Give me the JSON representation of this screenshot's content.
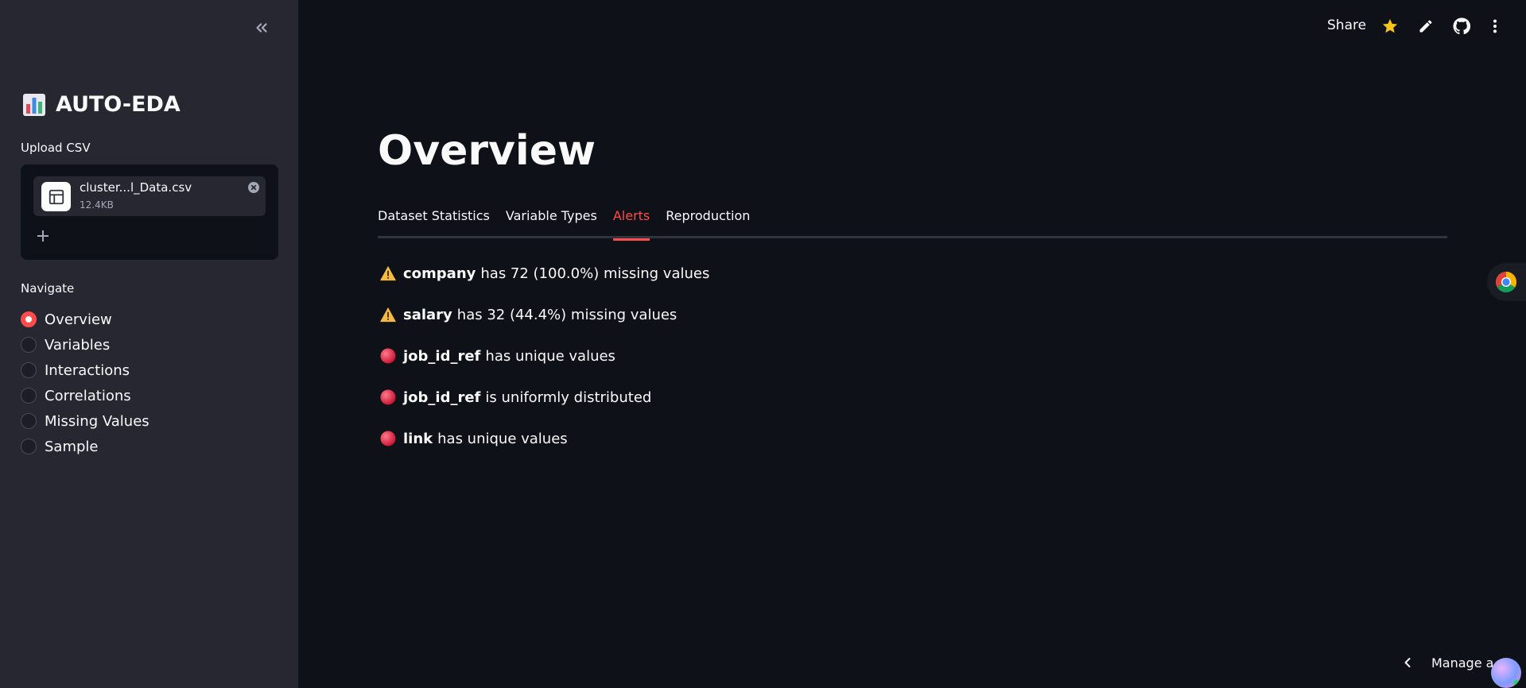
{
  "sidebar": {
    "title": "AUTO-EDA",
    "upload_label": "Upload CSV",
    "file": {
      "name": "cluster...l_Data.csv",
      "size": "12.4KB"
    },
    "nav_label": "Navigate",
    "nav_items": [
      {
        "label": "Overview",
        "selected": true
      },
      {
        "label": "Variables",
        "selected": false
      },
      {
        "label": "Interactions",
        "selected": false
      },
      {
        "label": "Correlations",
        "selected": false
      },
      {
        "label": "Missing Values",
        "selected": false
      },
      {
        "label": "Sample",
        "selected": false
      }
    ]
  },
  "header": {
    "share_label": "Share",
    "icons": [
      "star-icon",
      "pencil-icon",
      "github-icon",
      "more-vertical-icon"
    ]
  },
  "main": {
    "title": "Overview",
    "tabs": [
      {
        "label": "Dataset Statistics",
        "active": false
      },
      {
        "label": "Variable Types",
        "active": false
      },
      {
        "label": "Alerts",
        "active": true
      },
      {
        "label": "Reproduction",
        "active": false
      }
    ],
    "alerts": [
      {
        "icon": "warning-icon",
        "field": "company",
        "message": "has 72 (100.0%) missing values"
      },
      {
        "icon": "warning-icon",
        "field": "salary",
        "message": "has 32 (44.4%) missing values"
      },
      {
        "icon": "red-circle-icon",
        "field": "job_id_ref",
        "message": "has unique values"
      },
      {
        "icon": "red-circle-icon",
        "field": "job_id_ref",
        "message": "is uniformly distributed"
      },
      {
        "icon": "red-circle-icon",
        "field": "link",
        "message": "has unique values"
      }
    ]
  },
  "footer": {
    "manage_app_label": "Manage a"
  },
  "colors": {
    "accent": "#ff4b4b",
    "sidebar_bg": "#262730",
    "main_bg": "#0e1117",
    "star": "#f5c518"
  }
}
